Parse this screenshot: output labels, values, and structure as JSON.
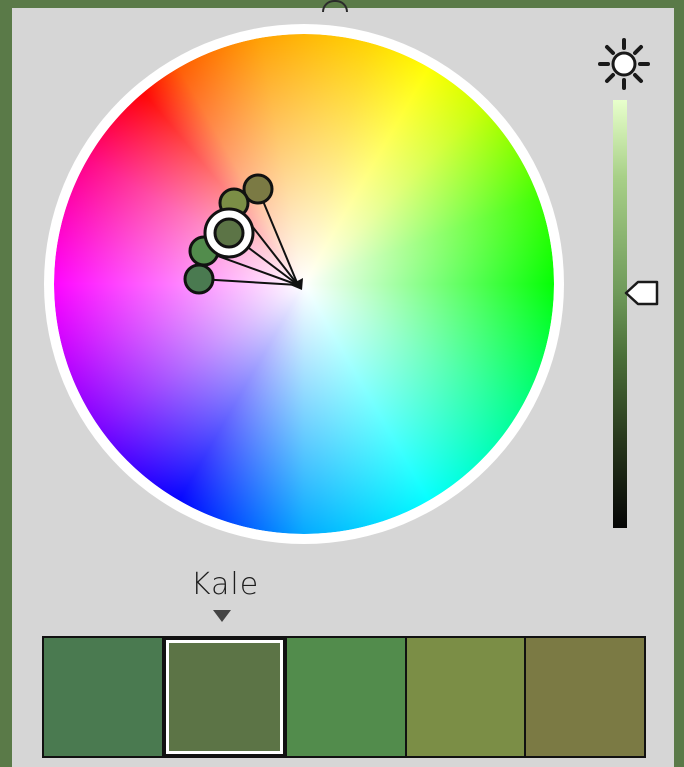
{
  "palette": {
    "selected_index": 1,
    "selected_name": "Kale",
    "swatches": [
      {
        "color": "#4a7a50"
      },
      {
        "color": "#5c7446"
      },
      {
        "color": "#528c4c"
      },
      {
        "color": "#7b8e46"
      },
      {
        "color": "#7b7a44"
      }
    ]
  },
  "brightness": {
    "icon": "sun-icon",
    "level": 0.55,
    "bar_top_color": "#e8ffcc",
    "bar_bottom_color": "#050505"
  },
  "wheel": {
    "handles": [
      {
        "color": "#7b7a44",
        "active": false
      },
      {
        "color": "#7b8e46",
        "active": false
      },
      {
        "color": "#5c7446",
        "active": true
      },
      {
        "color": "#528c4c",
        "active": false
      },
      {
        "color": "#4a7a50",
        "active": false
      }
    ]
  }
}
